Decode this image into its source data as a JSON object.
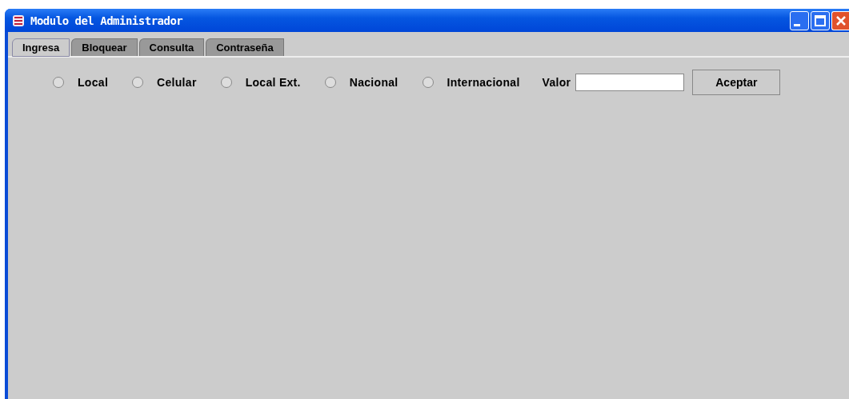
{
  "window": {
    "title": "Modulo del Administrador"
  },
  "tabs": [
    {
      "label": "Ingresa",
      "selected": true
    },
    {
      "label": "Bloquear",
      "selected": false
    },
    {
      "label": "Consulta",
      "selected": false
    },
    {
      "label": "Contraseña",
      "selected": false
    }
  ],
  "options": [
    {
      "label": "Local",
      "selected": false
    },
    {
      "label": "Celular",
      "selected": false
    },
    {
      "label": "Local Ext.",
      "selected": false
    },
    {
      "label": "Nacional",
      "selected": false
    },
    {
      "label": "Internacional",
      "selected": false
    }
  ],
  "value_field": {
    "label": "Valor"
  },
  "buttons": [
    {
      "label": "Aceptar"
    }
  ]
}
